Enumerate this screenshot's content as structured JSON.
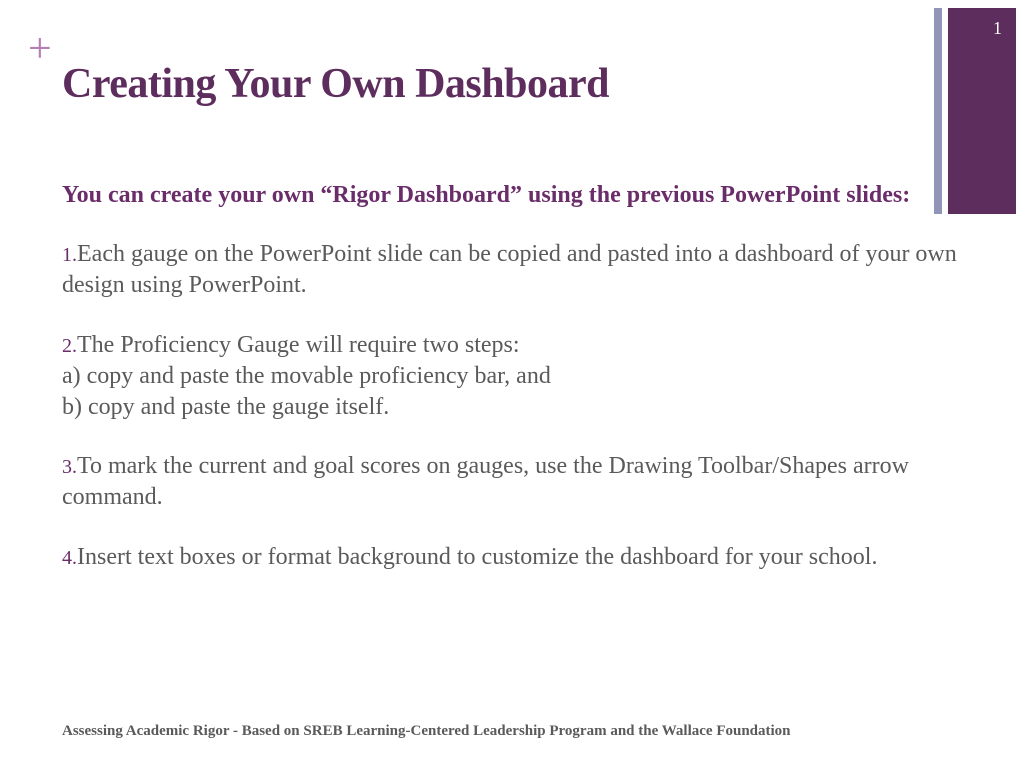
{
  "pageNumber": "1",
  "title": "Creating Your Own Dashboard",
  "intro": "You can create your own “Rigor Dashboard” using the previous PowerPoint slides:",
  "items": [
    {
      "number": "1.",
      "text": "Each gauge on the PowerPoint slide can be copied and pasted into a dashboard of your own design using PowerPoint."
    },
    {
      "number": "2.",
      "text": "The Proficiency Gauge will require two steps:\na) copy and paste the movable proficiency bar, and\nb) copy and paste the gauge itself."
    },
    {
      "number": "3.",
      "text": "To mark the current and goal scores on gauges, use the Drawing Toolbar/Shapes arrow command."
    },
    {
      "number": "4.",
      "text": "Insert text boxes or format background to customize the dashboard for your school."
    }
  ],
  "footer": "Assessing Academic Rigor - Based on SREB Learning-Centered Leadership Program and the Wallace Foundation"
}
